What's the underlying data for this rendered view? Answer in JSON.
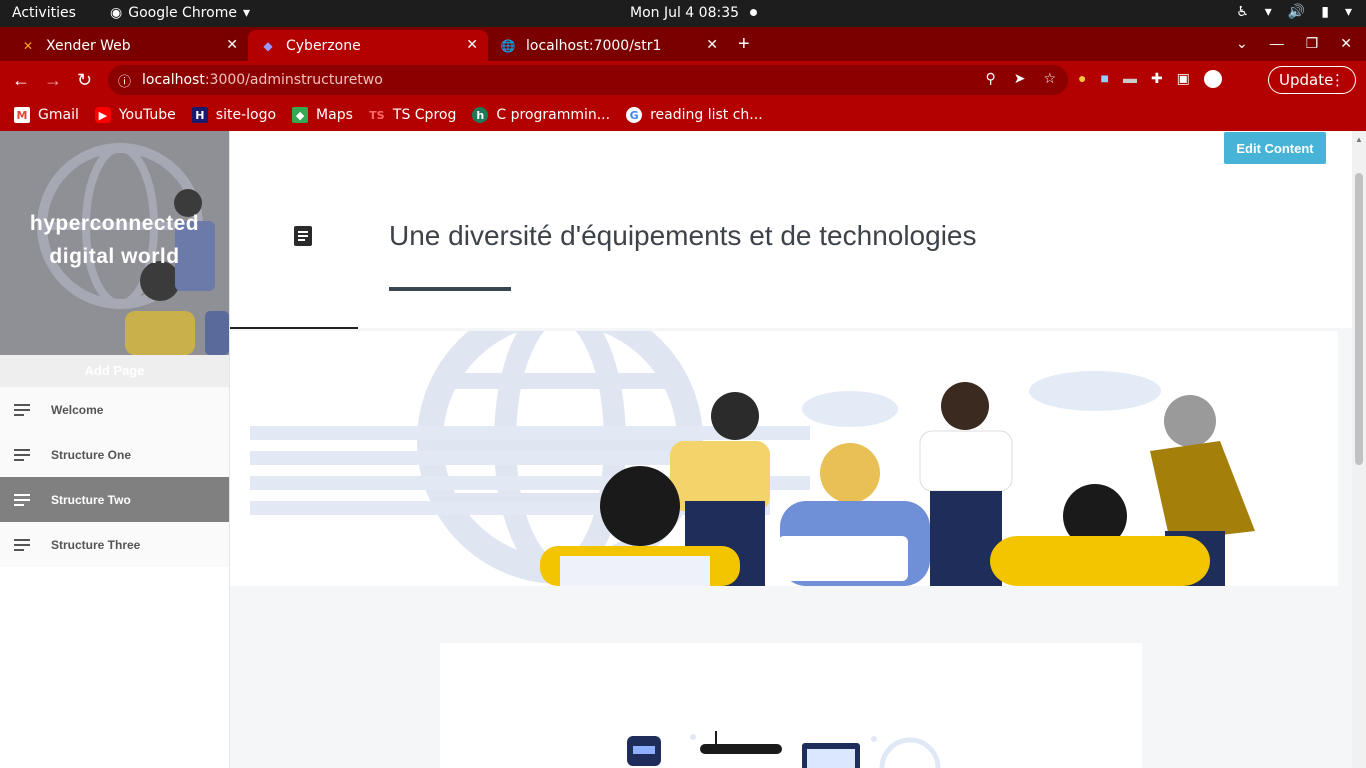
{
  "os_bar": {
    "activities": "Activities",
    "app_name": "Google Chrome",
    "clock": "Mon Jul 4  08:35"
  },
  "tabs": [
    {
      "title": "Xender Web",
      "icon": "xender-icon",
      "active": false
    },
    {
      "title": "Cyberzone",
      "icon": "cyberzone-icon",
      "active": true
    },
    {
      "title": "localhost:7000/str1",
      "icon": "globe-icon",
      "active": false
    }
  ],
  "address_bar": {
    "url_host": "localhost",
    "url_rest": ":3000/adminstructuretwo",
    "update_label": "Update"
  },
  "bookmarks": [
    {
      "label": "Gmail",
      "icon": "gmail-icon",
      "color": "#ea4335"
    },
    {
      "label": "YouTube",
      "icon": "youtube-icon",
      "color": "#ff0000"
    },
    {
      "label": "site-logo",
      "icon": "site-logo-icon",
      "color": "#1a1a6e"
    },
    {
      "label": "Maps",
      "icon": "maps-icon",
      "color": "#34a853"
    },
    {
      "label": "TS Cprog",
      "icon": "ts-icon",
      "color": "#3178c6"
    },
    {
      "label": "C programmin...",
      "icon": "c-prog-icon",
      "color": "#1f7a5a"
    },
    {
      "label": "reading list ch...",
      "icon": "google-icon",
      "color": "#4285f4"
    }
  ],
  "sidebar": {
    "hero_title": "hyperconnected digital world",
    "add_page": "Add Page",
    "items": [
      {
        "label": "Welcome",
        "active": false
      },
      {
        "label": "Structure One",
        "active": false
      },
      {
        "label": "Structure Two",
        "active": true
      },
      {
        "label": "Structure Three",
        "active": false
      }
    ]
  },
  "main": {
    "edit_button": "Edit Content",
    "title": "Une diversité d'équipements et de technologies"
  },
  "colors": {
    "browser_accent": "#b30000",
    "tabstrip": "#7a0000",
    "edit_button": "#47b3d6",
    "active_nav": "#808080"
  }
}
